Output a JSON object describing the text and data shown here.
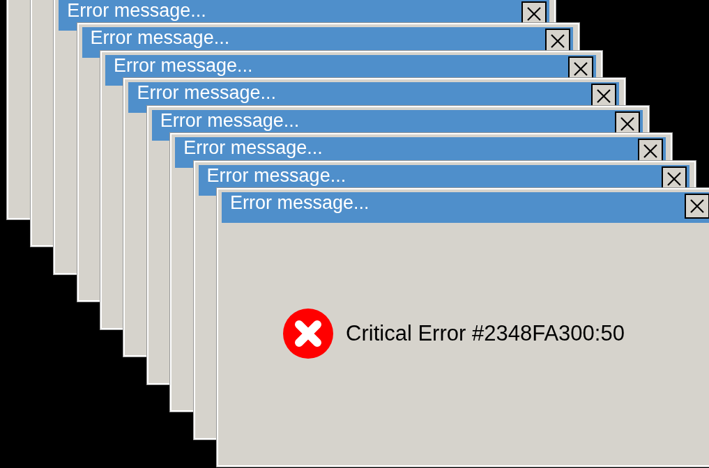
{
  "windows": [
    {
      "kind": "empty"
    },
    {
      "kind": "empty"
    },
    {
      "title": "Error message...",
      "kind": "empty"
    },
    {
      "title": "Error message...",
      "kind": "empty"
    },
    {
      "title": "Error message...",
      "kind": "empty"
    },
    {
      "title": "Error message...",
      "kind": "empty"
    },
    {
      "title": "Error message...",
      "kind": "empty"
    },
    {
      "title": "Error message...",
      "kind": "empty"
    },
    {
      "title": "Error message...",
      "kind": "empty"
    },
    {
      "title": "Error message...",
      "kind": "message",
      "message": "Critical Error #2348FA300:50"
    }
  ]
}
